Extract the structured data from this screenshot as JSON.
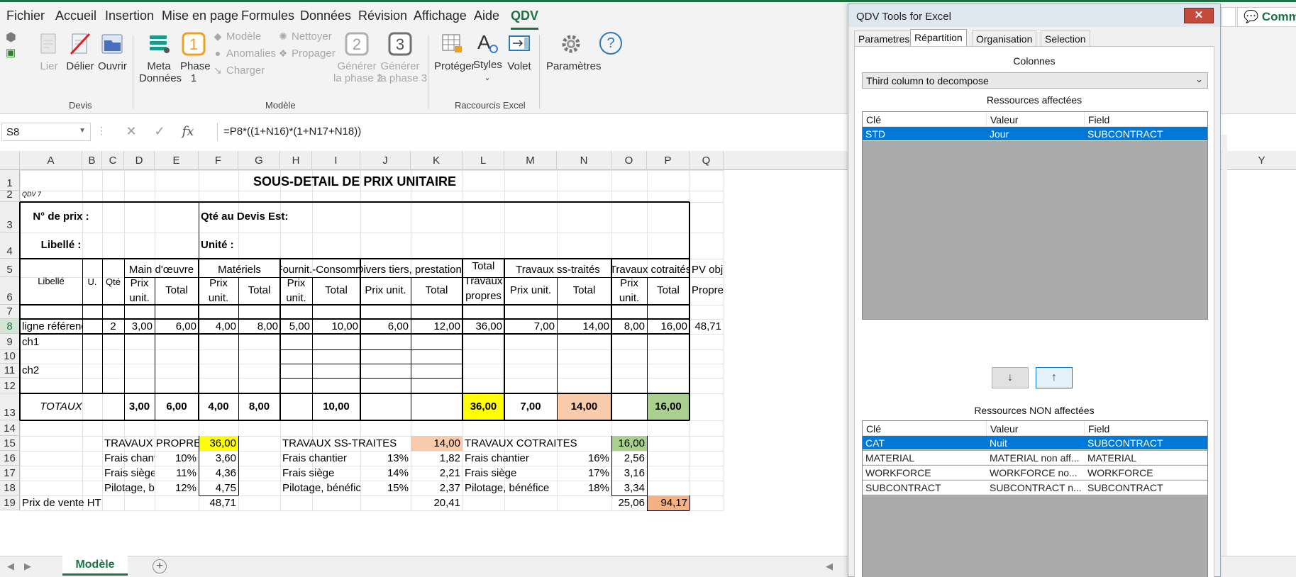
{
  "ribbon_tabs": [
    "Fichier",
    "Accueil",
    "Insertion",
    "Mise en page",
    "Formules",
    "Données",
    "Révision",
    "Affichage",
    "Aide",
    "QDV"
  ],
  "active_tab": "QDV",
  "ribbon": {
    "devis": {
      "lier": "Lier",
      "delier": "Délier",
      "ouvrir": "Ouvrir",
      "label": "Devis"
    },
    "modele": {
      "meta_line1": "Meta",
      "meta_line2": "Données",
      "phase1_line1": "Phase",
      "phase1_line2": "1",
      "modele": "Modèle",
      "anomalies": "Anomalies",
      "charger": "Charger",
      "nettoyer": "Nettoyer",
      "propager": "Propager",
      "gen2_line1": "Générer",
      "gen2_line2": "la phase 2",
      "gen3_line1": "Générer",
      "gen3_line2": "la phase 3",
      "label": "Modèle"
    },
    "raccourcis": {
      "proteger": "Protéger",
      "styles": "Styles",
      "volet": "Volet",
      "label": "Raccourcis Excel"
    },
    "parametres": "Paramètres"
  },
  "formula_bar": {
    "name_box": "S8",
    "formula": "=P8*((1+N16)*(1+N17+N18))"
  },
  "columns": [
    "A",
    "B",
    "C",
    "D",
    "E",
    "F",
    "G",
    "H",
    "I",
    "J",
    "K",
    "L",
    "M",
    "N",
    "O",
    "P",
    "Q"
  ],
  "column_far": "Y",
  "rows": [
    "1",
    "2",
    "3",
    "4",
    "5",
    "6",
    "7",
    "8",
    "9",
    "10",
    "11",
    "12",
    "13",
    "14",
    "15",
    "16",
    "17",
    "18",
    "19"
  ],
  "selected_row": "8",
  "sheet": {
    "title": "SOUS-DETAIL DE PRIX UNITAIRE",
    "qdv_tag": "QDV 7",
    "no_prix": "N° de prix :",
    "qte_devis": "Qté au Devis Est:",
    "libelle_label": "Libellé :",
    "unite": "Unité :",
    "hdr_libelle": "Libellé",
    "hdr_u": "U.",
    "hdr_qte": "Qté",
    "hdr_main": "Main d'œuvre",
    "hdr_materiels": "Matériels",
    "hdr_fournit": "Fournit.-Consomm",
    "hdr_divers": "Divers tiers, prestations",
    "hdr_total_line1": "Total",
    "hdr_total_line2": "Travaux",
    "hdr_total_line3": "propres",
    "hdr_ss": "Travaux ss-traités",
    "hdr_cot": "Travaux cotraités",
    "hdr_pv": "PV objec",
    "hdr_propre": "Propre",
    "prix_unit_a": "Prix",
    "prix_unit_b": "unit.",
    "prix_unit": "Prix unit.",
    "total": "Total",
    "row8": {
      "libelle": "ligne référence",
      "qte": "2",
      "d": "3,00",
      "e": "6,00",
      "f": "4,00",
      "g": "8,00",
      "h": "5,00",
      "i": "10,00",
      "j": "6,00",
      "k": "12,00",
      "l": "36,00",
      "m": "7,00",
      "n": "14,00",
      "o": "8,00",
      "p": "16,00",
      "q": "48,71"
    },
    "row9": "ch1",
    "row11": "ch2",
    "totaux": {
      "label": "TOTAUX",
      "d": "3,00",
      "e": "6,00",
      "f": "4,00",
      "g": "8,00",
      "i": "10,00",
      "l": "36,00",
      "m": "7,00",
      "n": "14,00",
      "p": "16,00"
    },
    "recap": {
      "tp": "TRAVAUX PROPRES",
      "tp_v": "36,00",
      "tss": "TRAVAUX SS-TRAITES",
      "tss_v": "14,00",
      "tc": "TRAVAUX COTRAITES",
      "tc_v": "16,00",
      "fc": "Frais chantier",
      "fs": "Frais siège",
      "pb": "Pilotage, bénéf",
      "pb2": "Pilotage, bénéfice",
      "c1": [
        "10%",
        "11%",
        "12%"
      ],
      "v1": [
        "3,60",
        "4,36",
        "4,75"
      ],
      "c2": [
        "13%",
        "14%",
        "15%"
      ],
      "v2": [
        "1,82",
        "2,21",
        "2,37"
      ],
      "c3": [
        "16%",
        "17%",
        "18%"
      ],
      "v3": [
        "2,56",
        "3,16",
        "3,34"
      ],
      "pv": "Prix de vente HT",
      "pv1": "48,71",
      "pv2": "20,41",
      "pv3": "25,06",
      "pv_total": "94,17"
    }
  },
  "sheet_tab": "Modèle",
  "panel": {
    "title": "QDV Tools for Excel",
    "close": "✕",
    "tabs": [
      "Parametres",
      "Répartition",
      "Organisation",
      "Selection"
    ],
    "active_tab": "Répartition",
    "colonnes": "Colonnes",
    "combo": "Third column to decompose",
    "affectees": "Ressources affectées",
    "non_affectees": "Ressources NON affectées",
    "headers": [
      "Clé",
      "Valeur",
      "Field"
    ],
    "assigned": [
      {
        "cle": "STD",
        "valeur": "Jour",
        "field": "SUBCONTRACT"
      }
    ],
    "unassigned": [
      {
        "cle": "CAT",
        "valeur": "Nuit",
        "field": "SUBCONTRACT"
      },
      {
        "cle": "MATERIAL",
        "valeur": "MATERIAL non aff...",
        "field": "MATERIAL"
      },
      {
        "cle": "WORKFORCE",
        "valeur": "WORKFORCE no...",
        "field": "WORKFORCE"
      },
      {
        "cle": "SUBCONTRACT",
        "valeur": "SUBCONTRACT n...",
        "field": "SUBCONTRACT"
      }
    ],
    "down": "↓",
    "up": "↑"
  },
  "comments_button": "Comm",
  "colors": {
    "excel_green": "#1e7145",
    "yellow": "#ffff00",
    "peach": "#f8cbad",
    "green_fill": "#a9d08e",
    "orange_fill": "#f4b183",
    "selection_blue": "#0078d7"
  }
}
